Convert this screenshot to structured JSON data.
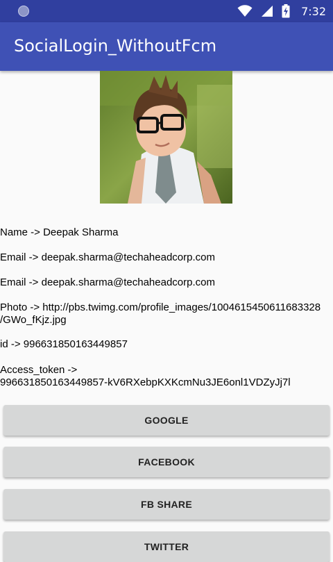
{
  "status_bar": {
    "time": "7:32",
    "notification_icon": "circle-icon",
    "wifi_icon": "wifi-icon",
    "signal_icon": "cell-signal-icon",
    "battery_icon": "battery-charging-icon",
    "color": "#303f9f"
  },
  "app_bar": {
    "title": "SocialLogin_WithoutFcm",
    "color": "#3f51b5"
  },
  "profile": {
    "name_line": "Name -> Deepak Sharma",
    "email_line_1": "Email -> deepak.sharma@techaheadcorp.com",
    "email_line_2": "Email -> deepak.sharma@techaheadcorp.com",
    "photo_line_1": "Photo -> http://pbs.twimg.com/profile_images/1004615450611683328",
    "photo_line_2": "/GWo_fKjz.jpg",
    "id_line": "id -> 996631850163449857",
    "token_line_1": "Access_token ->",
    "token_line_2": "996631850163449857-kV6RXebpKXKcmNu3JE6onl1VDZyJj7l"
  },
  "buttons": {
    "google": "GOOGLE",
    "facebook": "FACEBOOK",
    "fb_share": "FB SHARE",
    "twitter": "TWITTER"
  }
}
